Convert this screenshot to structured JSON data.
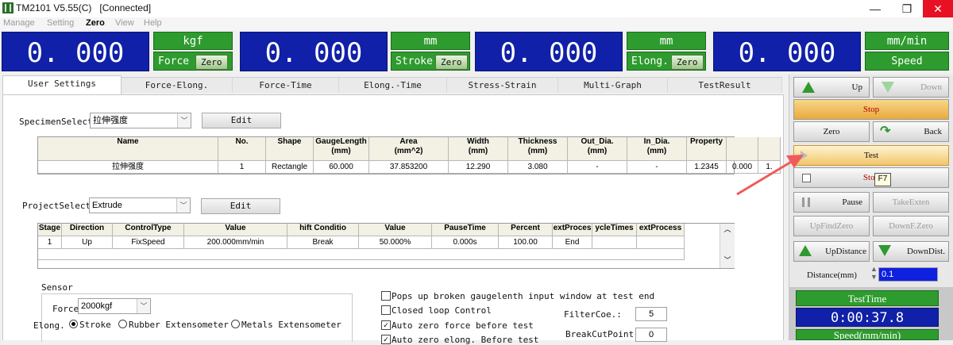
{
  "window": {
    "title": "TM2101 V5.55(C)",
    "status": "[Connected]",
    "minimize": "—",
    "restore": "❐",
    "close": "✕"
  },
  "menu": [
    "Manage",
    "Setting",
    "Zero",
    "View",
    "Help"
  ],
  "readouts": {
    "force": {
      "value": "0. 000",
      "unit": "kgf",
      "label": "Force",
      "zero": "Zero"
    },
    "stroke": {
      "value": "0. 000",
      "unit": "mm",
      "label": "Stroke",
      "zero": "Zero"
    },
    "elong": {
      "value": "0. 000",
      "unit": "mm",
      "label": "Elong.",
      "zero": "Zero"
    },
    "speed": {
      "value": "0. 000",
      "unit": "mm/min",
      "label": "Speed"
    }
  },
  "tabs": [
    "User Settings",
    "Force-Elong.",
    "Force-Time",
    "Elong.-Time",
    "Stress-Strain",
    "Multi-Graph",
    "TestResult"
  ],
  "specimen": {
    "label": "SpecimenSelect",
    "value": "拉伸强度",
    "edit": "Edit",
    "headers": [
      "Name",
      "No.",
      "Shape",
      "GaugeLength\n(mm)",
      "Area\n(mm^2)",
      "Width\n(mm)",
      "Thickness\n(mm)",
      "Out_Dia.\n(mm)",
      "In_Dia.\n(mm)",
      "Property",
      "",
      ""
    ],
    "row": [
      "拉伸强度",
      "1",
      "Rectangle",
      "60.000",
      "37.853200",
      "12.290",
      "3.080",
      "-",
      "-",
      "1.2345",
      "0.000",
      "1."
    ]
  },
  "project": {
    "label": "ProjectSelect",
    "value": "Extrude",
    "edit": "Edit",
    "headers": [
      "Stage",
      "Direction",
      "ControlType",
      "Value",
      "hift Conditio",
      "Value",
      "PauseTime",
      "Percent",
      "extProces",
      "ycleTimes",
      "extProcess"
    ],
    "row": [
      "1",
      "Up",
      "FixSpeed",
      "200.000mm/min",
      "Break",
      "50.000%",
      "0.000s",
      "100.00",
      "End",
      "",
      ""
    ]
  },
  "sensor": {
    "title": "Sensor",
    "force_label": "Force",
    "force_value": "2000kgf",
    "elong_label": "Elong.",
    "options": [
      "Stroke",
      "Rubber Extensometer",
      "Metals Extensometer"
    ]
  },
  "options": [
    {
      "label": "Pops up broken gaugelenth input window at test end",
      "checked": false
    },
    {
      "label": "Closed loop Control",
      "checked": false
    },
    {
      "label": "Auto zero force before test",
      "checked": true
    },
    {
      "label": "Auto zero elong. Before test",
      "checked": true
    }
  ],
  "params": {
    "filter_label": "FilterCoe.:",
    "filter_value": "5",
    "breakcut_label": "BreakCutPoint",
    "breakcut_value": "0"
  },
  "controls": {
    "up": "Up",
    "down": "Down",
    "stop": "Stop",
    "zero": "Zero",
    "back": "Back",
    "test": "Test",
    "stop2": "Stop",
    "f7": "F7",
    "pause": "Pause",
    "take_exten": "TakeExten",
    "up_find_zero": "UpFindZero",
    "down_f_zero": "DownF.Zero",
    "up_distance": "UpDistance",
    "down_dist": "DownDist.",
    "distance_label": "Distance(mm)",
    "distance_value": "0.1",
    "test_time_label": "TestTime",
    "test_time_value": "0:00:37.8",
    "speed_label": "Speed(mm/min)"
  }
}
